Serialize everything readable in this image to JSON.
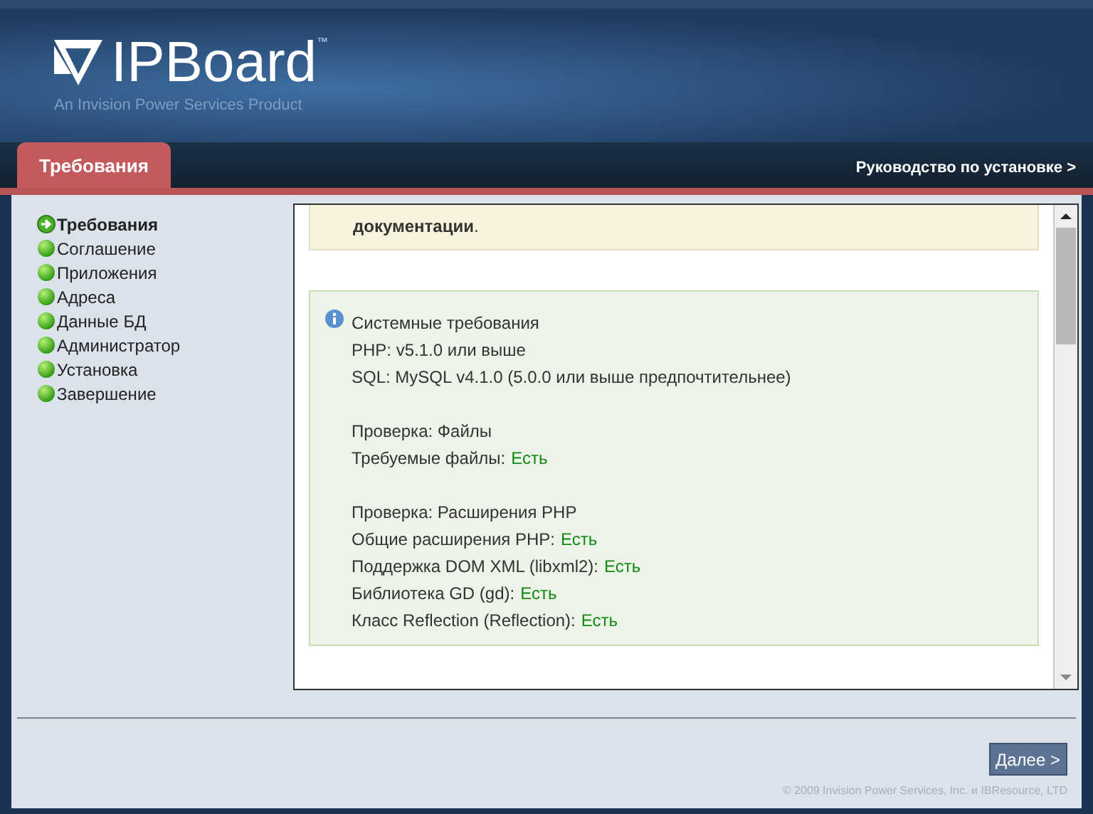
{
  "header": {
    "logo_text": "IPBoard",
    "trademark": "™",
    "tagline": "An Invision Power Services Product"
  },
  "tab": {
    "label": "Требования"
  },
  "guide_link": "Руководство по установке >",
  "sidebar": {
    "items": [
      {
        "label": "Требования",
        "selected": true
      },
      {
        "label": "Соглашение",
        "selected": false
      },
      {
        "label": "Приложения",
        "selected": false
      },
      {
        "label": "Адреса",
        "selected": false
      },
      {
        "label": "Данные БД",
        "selected": false
      },
      {
        "label": "Администратор",
        "selected": false
      },
      {
        "label": "Установка",
        "selected": false
      },
      {
        "label": "Завершение",
        "selected": false
      }
    ]
  },
  "notice": {
    "bold": "документации",
    "tail": "."
  },
  "requirements": {
    "groups": [
      {
        "lines": [
          {
            "label": "Системные требования"
          },
          {
            "label": "PHP: v5.1.0 или выше"
          },
          {
            "label": "SQL: MySQL v4.1.0 (5.0.0 или выше предпочтительнее)"
          }
        ]
      },
      {
        "lines": [
          {
            "label": "Проверка: Файлы"
          },
          {
            "label": "Требуемые файлы:",
            "value": "Есть"
          }
        ]
      },
      {
        "lines": [
          {
            "label": "Проверка: Расширения PHP"
          },
          {
            "label": "Общие расширения PHP:",
            "value": "Есть"
          },
          {
            "label": "Поддержка DOM XML (libxml2):",
            "value": "Есть"
          },
          {
            "label": "Библиотека GD (gd):",
            "value": "Есть"
          },
          {
            "label": "Класс Reflection (Reflection):",
            "value": "Есть"
          }
        ]
      }
    ]
  },
  "next_button": "Далее >",
  "copyright": "© 2009 Invision Power Services, Inc. и IBResource, LTD"
}
